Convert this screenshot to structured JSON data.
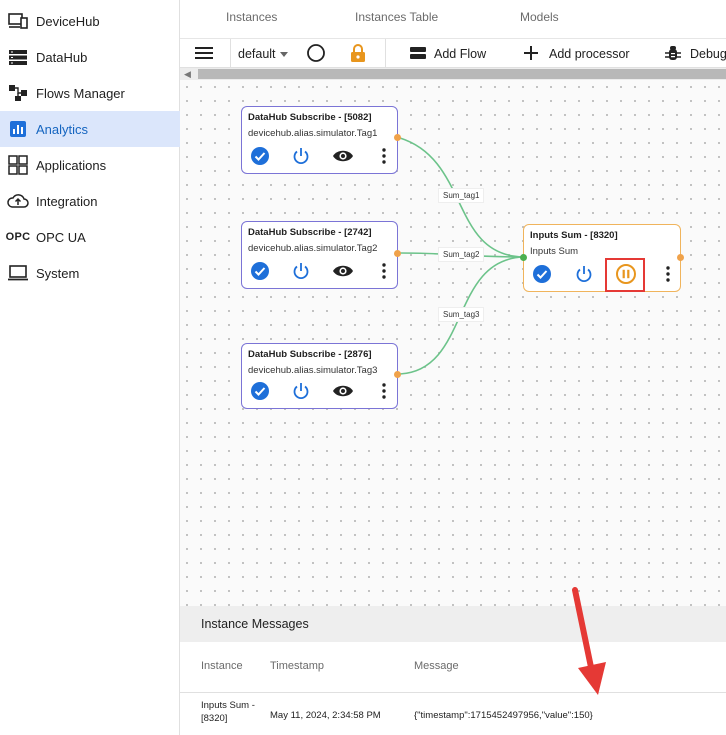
{
  "sidebar": {
    "items": [
      {
        "label": "DeviceHub",
        "icon": "devices-icon"
      },
      {
        "label": "DataHub",
        "icon": "storage-icon"
      },
      {
        "label": "Flows Manager",
        "icon": "flow-icon"
      },
      {
        "label": "Analytics",
        "icon": "analytics-icon",
        "active": true
      },
      {
        "label": "Applications",
        "icon": "apps-icon"
      },
      {
        "label": "Integration",
        "icon": "cloud-upload-icon"
      },
      {
        "label": "OPC UA",
        "icon": "opc-icon",
        "icon_text": "OPC"
      },
      {
        "label": "System",
        "icon": "laptop-icon"
      }
    ]
  },
  "tabs": [
    "Instances",
    "Instances Table",
    "Models"
  ],
  "toolbar": {
    "select_value": "default",
    "add_flow": "Add Flow",
    "add_processor": "Add processor",
    "debug": "Debug"
  },
  "nodes": [
    {
      "title": "DataHub Subscribe - [5082]",
      "subtitle": "devicehub.alias.simulator.Tag1"
    },
    {
      "title": "DataHub Subscribe - [2742]",
      "subtitle": "devicehub.alias.simulator.Tag2"
    },
    {
      "title": "DataHub Subscribe - [2876]",
      "subtitle": "devicehub.alias.simulator.Tag3"
    },
    {
      "title": "Inputs Sum - [8320]",
      "subtitle": "Inputs Sum"
    }
  ],
  "edges": [
    "Sum_tag1",
    "Sum_tag2",
    "Sum_tag3"
  ],
  "messages": {
    "title": "Instance Messages",
    "columns": [
      "Instance",
      "Timestamp",
      "Message"
    ],
    "rows": [
      {
        "instance_line1": "Inputs Sum -",
        "instance_line2": "[8320]",
        "timestamp": "May 11, 2024, 2:34:58 PM",
        "message": "{\"timestamp\":1715452497956,\"value\":150}"
      }
    ]
  },
  "colors": {
    "accent": "#1e6fd9",
    "node_border": "#7b74d6",
    "pause_orange": "#e8961e",
    "annotation_red": "#e53935",
    "edge_green": "#6cc38a"
  }
}
